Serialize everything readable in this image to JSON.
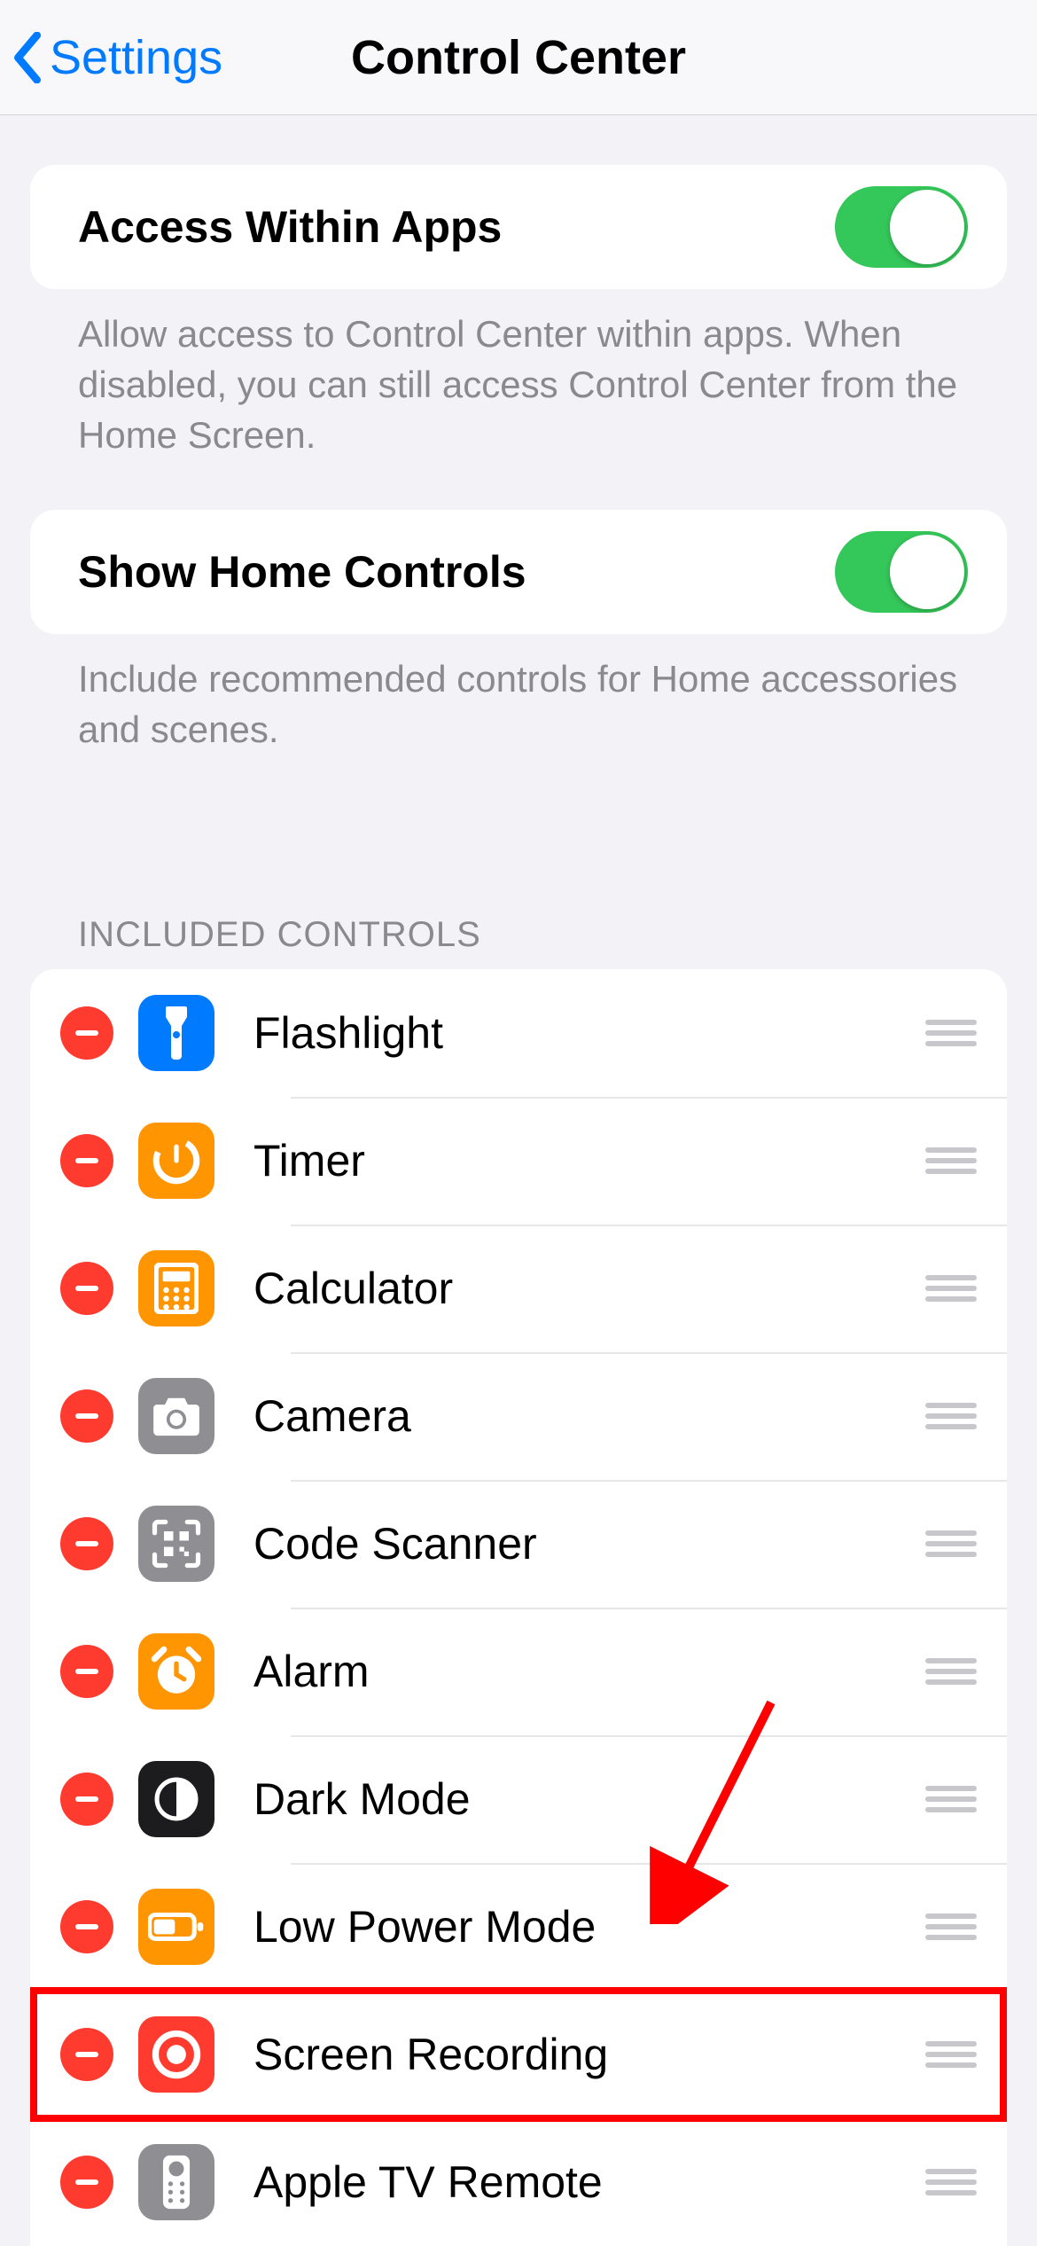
{
  "nav": {
    "back": "Settings",
    "title": "Control Center"
  },
  "sections": {
    "access": {
      "label": "Access Within Apps",
      "on": true,
      "footer": "Allow access to Control Center within apps. When disabled, you can still access Control Center from the Home Screen."
    },
    "home": {
      "label": "Show Home Controls",
      "on": true,
      "footer": "Include recommended controls for Home accessories and scenes."
    },
    "included_header": "INCLUDED CONTROLS",
    "included": [
      {
        "label": "Flashlight",
        "icon": "flashlight",
        "bg": "#007aff"
      },
      {
        "label": "Timer",
        "icon": "timer",
        "bg": "#ff9500"
      },
      {
        "label": "Calculator",
        "icon": "calculator",
        "bg": "#ff9500"
      },
      {
        "label": "Camera",
        "icon": "camera",
        "bg": "#8e8e93"
      },
      {
        "label": "Code Scanner",
        "icon": "qr",
        "bg": "#8e8e93"
      },
      {
        "label": "Alarm",
        "icon": "alarm",
        "bg": "#ff9500"
      },
      {
        "label": "Dark Mode",
        "icon": "darkmode",
        "bg": "#1c1c1e"
      },
      {
        "label": "Low Power Mode",
        "icon": "battery",
        "bg": "#ff9500"
      },
      {
        "label": "Screen Recording",
        "icon": "record",
        "bg": "#ff3b30"
      },
      {
        "label": "Apple TV Remote",
        "icon": "remote",
        "bg": "#8e8e93"
      }
    ]
  },
  "annotations": {
    "highlight_index": 8,
    "arrow": true
  },
  "colors": {
    "accent": "#007aff",
    "green": "#34c759",
    "red": "#ff3b30",
    "orange": "#ff9500",
    "gray": "#8e8e93"
  }
}
